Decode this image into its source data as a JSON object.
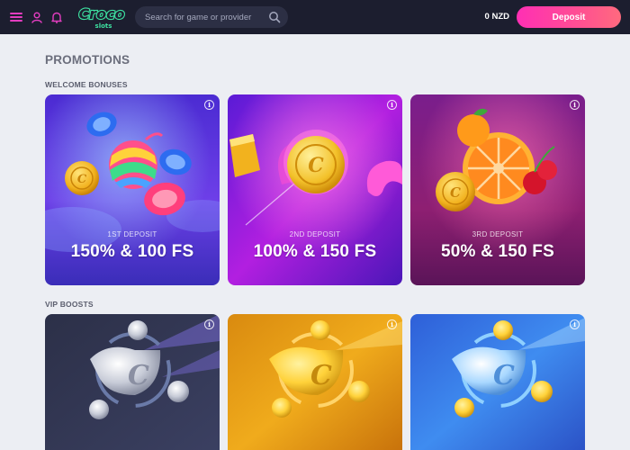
{
  "header": {
    "logo_text": "Croco",
    "logo_subtext": "slots",
    "search_placeholder": "Search for game or provider",
    "balance": "0 NZD",
    "deposit_label": "Deposit",
    "icons": [
      "menu-icon",
      "user-icon",
      "bell-icon",
      "search-icon"
    ],
    "colors": {
      "header_bg": "#1c1e2f",
      "accent_pink": "#ff2fb4",
      "logo_green": "#3de0a0"
    }
  },
  "page": {
    "title": "PROMOTIONS",
    "welcome_section_title": "WELCOME BONUSES",
    "vip_section_title": "VIP BOOSTS"
  },
  "welcome_cards": [
    {
      "subtitle": "1ST DEPOSIT",
      "headline": "150% & 100 FS"
    },
    {
      "subtitle": "2ND DEPOSIT",
      "headline": "100% & 150 FS"
    },
    {
      "subtitle": "3RD DEPOSIT",
      "headline": "50% & 150 FS"
    }
  ],
  "vip_cards": [
    {
      "theme": "silver"
    },
    {
      "theme": "gold"
    },
    {
      "theme": "diamond"
    }
  ],
  "info_icon_glyph": "i"
}
